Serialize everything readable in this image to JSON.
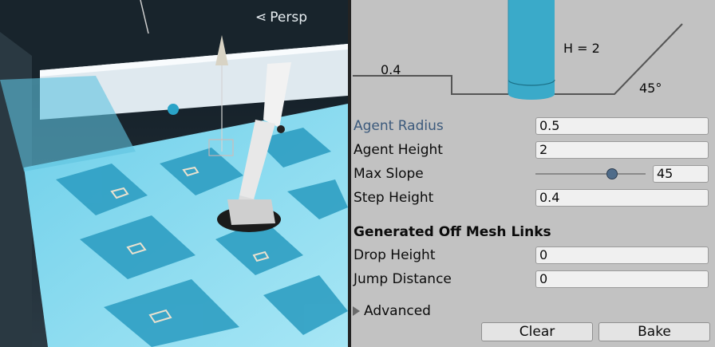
{
  "scene": {
    "view_label": "Persp",
    "view_icon": "perspective-icon"
  },
  "diagram": {
    "step_label": "0.4",
    "height_label": "H = 2",
    "slope_label": "45°"
  },
  "settings": {
    "agent_radius": {
      "label": "Agent Radius",
      "value": "0.5"
    },
    "agent_height": {
      "label": "Agent Height",
      "value": "2"
    },
    "max_slope": {
      "label": "Max Slope",
      "value": "45",
      "slider_fraction": 0.72
    },
    "step_height": {
      "label": "Step Height",
      "value": "0.4"
    }
  },
  "offmesh": {
    "title": "Generated Off Mesh Links",
    "drop_height": {
      "label": "Drop Height",
      "value": "0"
    },
    "jump_distance": {
      "label": "Jump Distance",
      "value": "0"
    }
  },
  "advanced": {
    "label": "Advanced",
    "icon": "triangle-right-icon"
  },
  "buttons": {
    "clear": "Clear",
    "bake": "Bake"
  },
  "colors": {
    "accent": "#3aaac9",
    "label_highlight": "#3c5a7c",
    "panel_bg": "#c2c2c2"
  }
}
